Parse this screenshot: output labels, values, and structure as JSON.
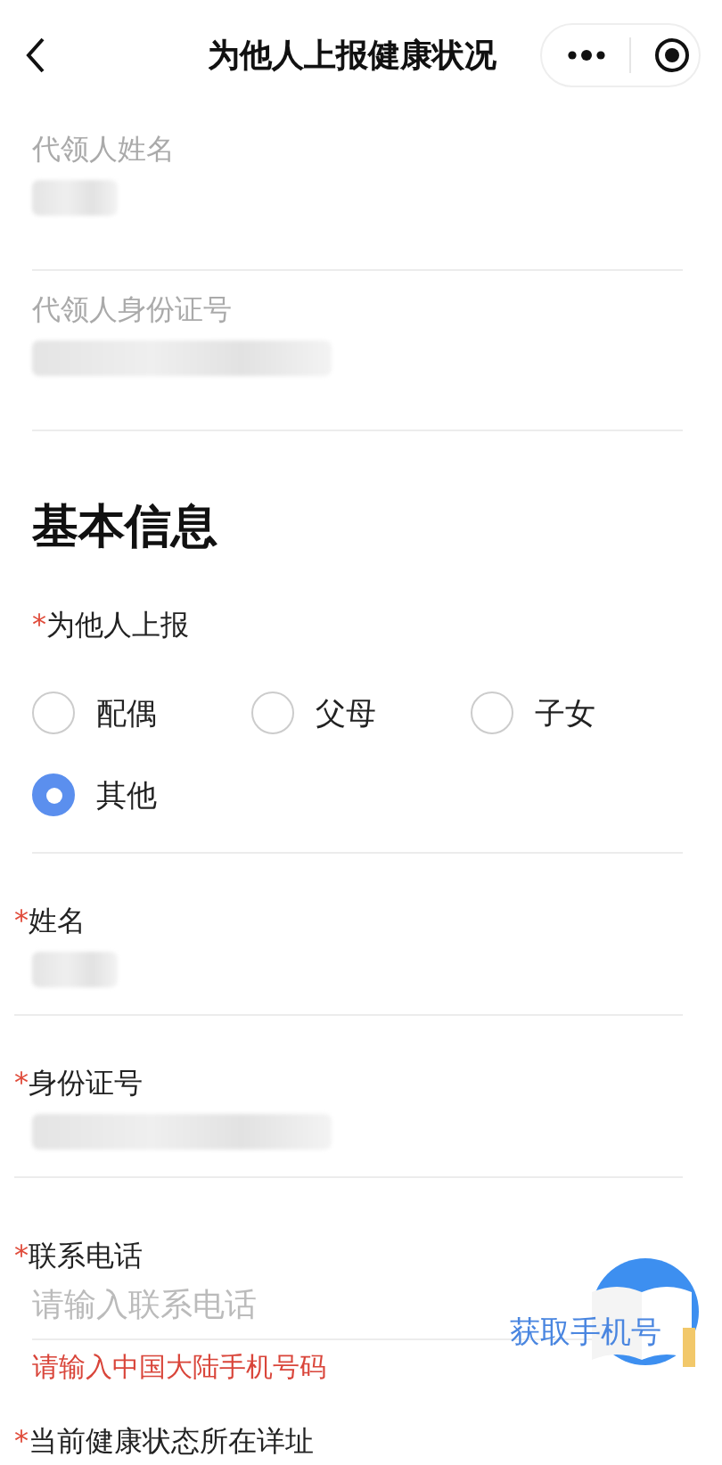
{
  "nav": {
    "title": "为他人上报健康状况"
  },
  "agent_fields": [
    {
      "label": "代领人姓名",
      "kind": "redacted_short"
    },
    {
      "label": "代领人身份证号",
      "kind": "redacted_long"
    }
  ],
  "section_title": "基本信息",
  "relation": {
    "required_mark": "*",
    "label": "为他人上报",
    "options": [
      {
        "label": "配偶",
        "selected": false
      },
      {
        "label": "父母",
        "selected": false
      },
      {
        "label": "子女",
        "selected": false
      },
      {
        "label": "其他",
        "selected": true
      }
    ]
  },
  "fields": [
    {
      "required_mark": "*",
      "label": "姓名",
      "kind": "redacted_short"
    },
    {
      "required_mark": "*",
      "label": "身份证号",
      "kind": "redacted_long"
    },
    {
      "required_mark": "*",
      "label": "联系电话",
      "kind": "input",
      "placeholder": "请输入联系电话",
      "error": "请输入中国大陆手机号码"
    },
    {
      "required_mark": "*",
      "label": "当前健康状态所在详址",
      "kind": "label_only"
    }
  ],
  "phone_button": {
    "label": "获取手机号"
  }
}
